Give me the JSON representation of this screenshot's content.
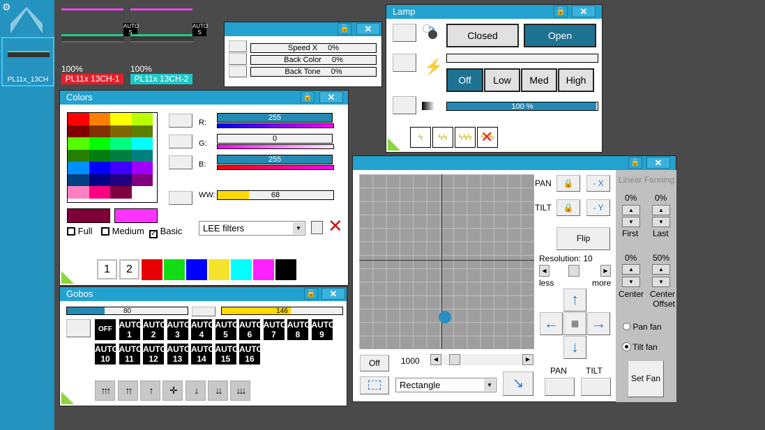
{
  "sidebar": {
    "fixture_label": "PL11x_13CH",
    "icons": [
      "gear-icon",
      "chevron-up-icon"
    ]
  },
  "fixtures": [
    {
      "name": "PL11x 13CH-1",
      "dimmer": "100%",
      "badge_top": "AUTO",
      "badge_bottom": "S",
      "label_color": "#e5202a"
    },
    {
      "name": "PL11x 13CH-2",
      "dimmer": "100%",
      "badge_top": "AUTO",
      "badge_bottom": "S",
      "label_color": "#1ec8c8"
    }
  ],
  "speed_window": {
    "rows": [
      {
        "label": "Speed X",
        "value": "0%"
      },
      {
        "label": "Back Color",
        "value": "0%"
      },
      {
        "label": "Back Tone",
        "value": "0%"
      }
    ]
  },
  "lamp": {
    "title": "Lamp",
    "closed": "Closed",
    "open": "Open",
    "levels": [
      "Off",
      "Low",
      "Med",
      "High"
    ],
    "selected_level": "Off",
    "intensity": "100 %",
    "intensity_value": 100
  },
  "colors": {
    "title": "Colors",
    "grid": [
      [
        "#ff0000",
        "#ff8000",
        "#ffff00",
        "#b9ff00"
      ],
      [
        "#800000",
        "#803300",
        "#806600",
        "#5c7f00"
      ],
      [
        "#55ff00",
        "#00ff00",
        "#00ff80",
        "#00ffff"
      ],
      [
        "#267f00",
        "#007f0e",
        "#007f40",
        "#007f7f"
      ],
      [
        "#0090ff",
        "#0000ff",
        "#4000ff",
        "#a000ff"
      ],
      [
        "#004080",
        "#000080",
        "#200080",
        "#800080"
      ],
      [
        "#ff80c0",
        "#ff0080",
        "#800040",
        "#ffffff"
      ]
    ],
    "current_colors": [
      "#7f0037",
      "#ff33ff"
    ],
    "r_label": "R:",
    "r_value": "255",
    "g_label": "G:",
    "g_value": "0",
    "b_label": "B:",
    "b_value": "255",
    "ww_label": "WW:",
    "ww_value": "68",
    "checkboxes": [
      {
        "label": "Full",
        "checked": false
      },
      {
        "label": "Medium",
        "checked": false
      },
      {
        "label": "Basic",
        "checked": true
      }
    ],
    "filter_select": "LEE filters",
    "presets": [
      "1",
      "2"
    ],
    "swatches": [
      "#e60000",
      "#14dc14",
      "#0000ff",
      "#f5e22a",
      "#00ffff",
      "#ff22ff",
      "#000000"
    ]
  },
  "gobos": {
    "title": "Gobos",
    "bar1_value": "80",
    "bar2_value": "146",
    "off_label": "OFF",
    "auto_label": "AUTO",
    "numbers": [
      "1",
      "2",
      "3",
      "4",
      "5",
      "6",
      "7",
      "8",
      "9",
      "10",
      "11",
      "12",
      "13",
      "14",
      "15",
      "16"
    ]
  },
  "xy": {
    "pan_label": "PAN",
    "tilt_label": "TILT",
    "invert_x": "- X",
    "invert_y": "- Y",
    "flip": "Flip",
    "resolution": "Resolution: 10",
    "less": "less",
    "more": "more",
    "off": "Off",
    "speed_value": "1000",
    "shape": "Rectangle",
    "pan_bottom": "PAN",
    "tilt_bottom": "TILT",
    "fanning": {
      "title": "Linear Fanning",
      "first_value": "0%",
      "last_value": "0%",
      "first": "First",
      "last": "Last",
      "center_value": "0%",
      "offset_value": "50%",
      "center": "Center",
      "center_offset": "Center Offset",
      "pan_fan": "Pan fan",
      "tilt_fan": "Tilt fan",
      "set_fan": "Set Fan"
    }
  }
}
